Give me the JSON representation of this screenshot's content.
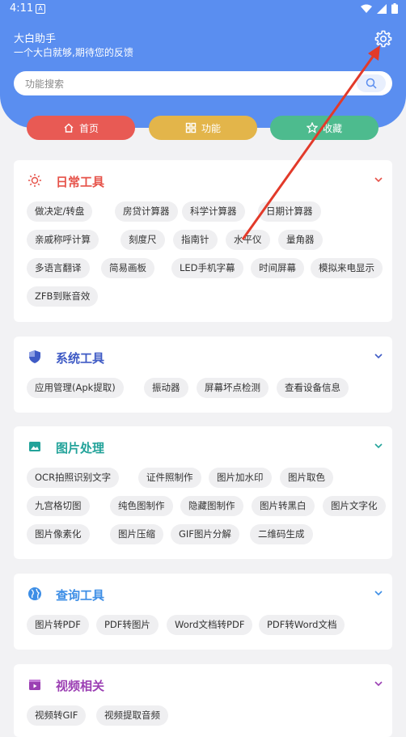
{
  "status": {
    "time": "4:11",
    "a_icon": "A"
  },
  "header": {
    "title": "大白助手",
    "subtitle": "一个大白就够,期待您的反馈",
    "search_placeholder": "功能搜索"
  },
  "nav": {
    "home": "首页",
    "functions": "功能",
    "favorites": "收藏"
  },
  "colors": {
    "header": "#5a8ef0",
    "home": "#e85a54",
    "functions": "#e3b54a",
    "favorites": "#4dbb8e",
    "daily": "#e6534a",
    "system": "#3f5bc5",
    "image": "#23a39a",
    "query": "#3d8ee6",
    "video": "#9b3fb3",
    "annotation_arrow": "#e23a2a"
  },
  "sections": [
    {
      "title": "日常工具",
      "icon": "sun-icon",
      "items": [
        "做决定/转盘",
        "房贷计算器",
        "科学计算器",
        "日期计算器",
        "亲戚称呼计算",
        "刻度尺",
        "指南针",
        "水平仪",
        "量角器",
        "多语言翻译",
        "简易画板",
        "LED手机字幕",
        "时间屏幕",
        "模拟来电显示",
        "ZFB到账音效"
      ]
    },
    {
      "title": "系统工具",
      "icon": "shield-icon",
      "items": [
        "应用管理(Apk提取)",
        "振动器",
        "屏幕坏点检测",
        "查看设备信息"
      ]
    },
    {
      "title": "图片处理",
      "icon": "image-icon",
      "items": [
        "OCR拍照识别文字",
        "证件照制作",
        "图片加水印",
        "图片取色",
        "九宫格切图",
        "纯色图制作",
        "隐藏图制作",
        "图片转黑白",
        "图片文字化",
        "图片像素化",
        "图片压缩",
        "GIF图片分解",
        "二维码生成"
      ]
    },
    {
      "title": "查询工具",
      "icon": "globe-icon",
      "items": [
        "图片转PDF",
        "PDF转图片",
        "Word文档转PDF",
        "PDF转Word文档"
      ]
    },
    {
      "title": "视频相关",
      "icon": "video-box-icon",
      "items": [
        "视频转GIF",
        "视频提取音频"
      ]
    }
  ]
}
